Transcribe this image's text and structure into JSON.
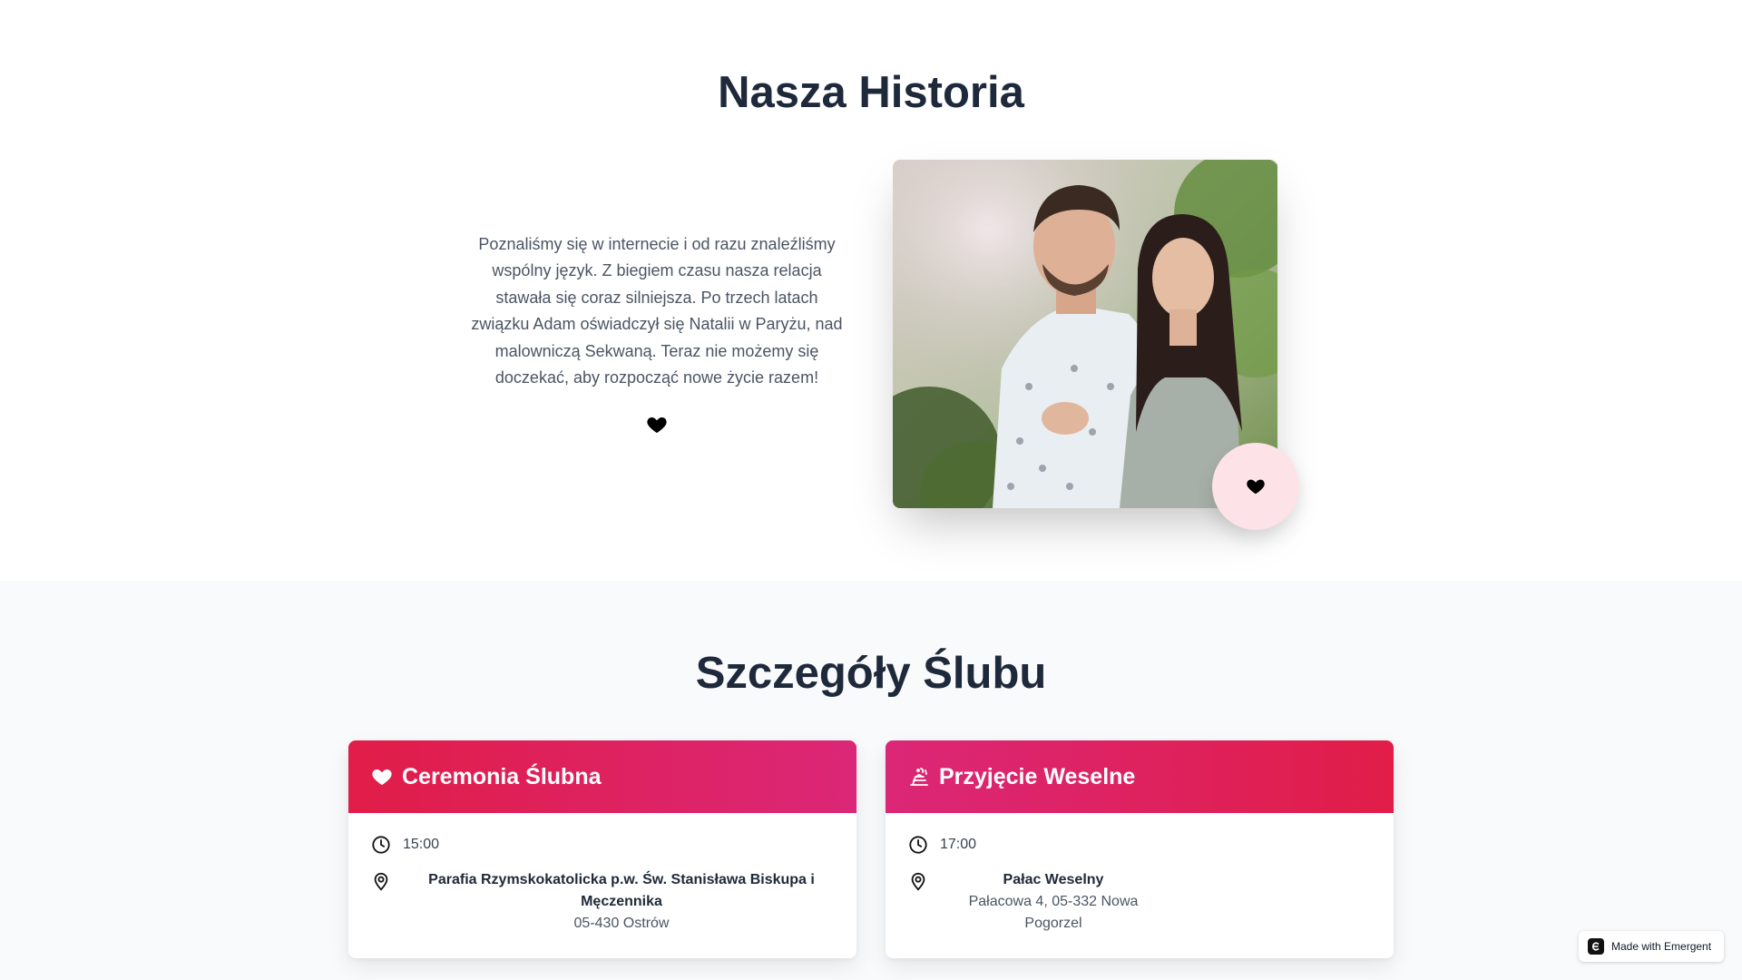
{
  "story": {
    "title": "Nasza Historia",
    "text": "Poznaliśmy się w internecie i od razu znaleźliśmy wspólny język. Z biegiem czasu nasza relacja stawała się coraz silniejsza. Po trzech latach związku Adam oświadczył się Natalii w Paryżu, nad malowniczą Sekwaną. Teraz nie możemy się doczekać, aby rozpocząć nowe życie razem!",
    "photo_icon": "couple-photo",
    "heart_icon": "heart-icon",
    "badge_bg_color": "#fde2e7"
  },
  "details": {
    "title": "Szczegóły Ślubu",
    "ceremony": {
      "title": "Ceremonia Ślubna",
      "icon": "heart-icon",
      "time": "15:00",
      "place_name": "Parafia Rzymskokatolicka p.w. Św. Stanisława Biskupa i Męczennika",
      "place_address": "05-430 Ostrów"
    },
    "reception": {
      "title": "Przyjęcie Weselne",
      "icon": "party-icon",
      "time": "17:00",
      "place_name": "Pałac Weselny",
      "place_address": "Pałacowa 4, 05-332 Nowa Pogorzel"
    },
    "accent_color": "#e11d48",
    "accent_color_2": "#db2777"
  },
  "made_with": {
    "label": "Made with Emergent"
  }
}
